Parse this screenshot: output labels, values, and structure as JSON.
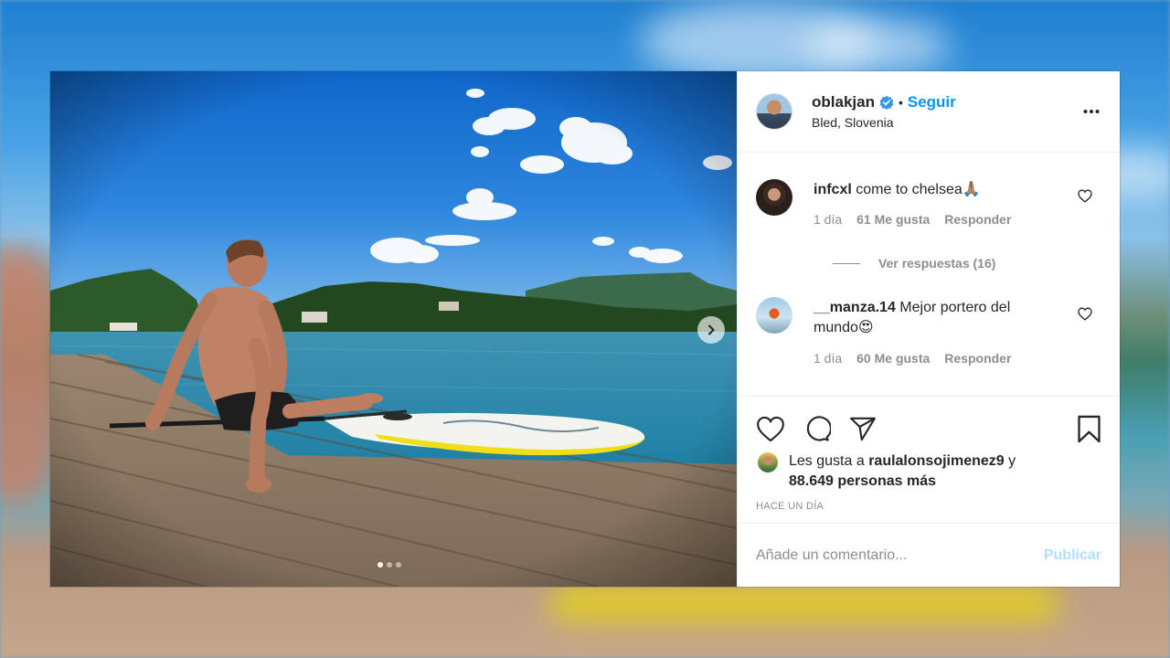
{
  "post": {
    "username": "oblakjan",
    "separator": "•",
    "follow_label": "Seguir",
    "location": "Bled, Slovenia"
  },
  "comments": [
    {
      "username": "infcxl",
      "text": "come to chelsea🙏🏽",
      "time": "1 día",
      "likes": "61 Me gusta",
      "reply_label": "Responder"
    },
    {
      "username": "__manza.14",
      "text": "Mejor portero del mundo😍",
      "time": "1 día",
      "likes": "60 Me gusta",
      "reply_label": "Responder"
    }
  ],
  "view_replies": "Ver respuestas (16)",
  "likes_summary": {
    "prefix": "Les gusta a",
    "user": "raulalonsojimenez9",
    "connector": "y",
    "others": "88.649 personas más"
  },
  "timestamp": "HACE UN DÍA",
  "comment_box": {
    "placeholder": "Añade un comentario...",
    "publish_label": "Publicar"
  },
  "carousel": {
    "slides": 3,
    "current": 1
  },
  "colors": {
    "link_blue": "#0095f6",
    "publish_disabled": "#b2dffc",
    "text_primary": "#262626",
    "text_secondary": "#8e8e8e",
    "verified_blue": "#3897f0"
  }
}
